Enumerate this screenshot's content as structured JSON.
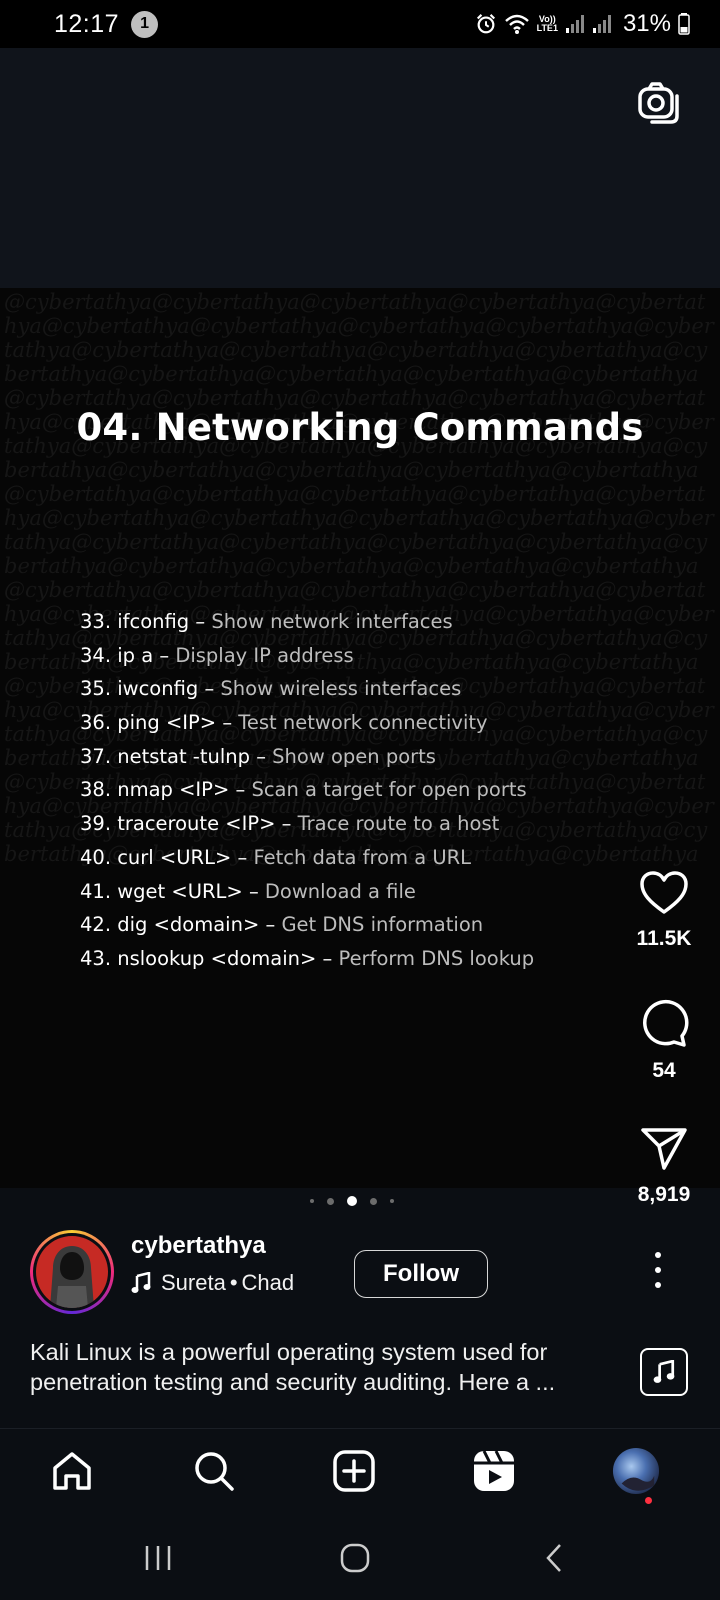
{
  "status_bar": {
    "time": "12:17",
    "notification_count": "1",
    "volte_top": "Vo))",
    "volte_bottom": "LTE1",
    "battery_percent": "31%"
  },
  "post": {
    "title": "04. Networking Commands",
    "commands": [
      {
        "cmd": "33. ifconfig – ",
        "desc": "Show network interfaces"
      },
      {
        "cmd": "34. ip a – ",
        "desc": "Display IP address"
      },
      {
        "cmd": "35. iwconfig – ",
        "desc": "Show wireless interfaces"
      },
      {
        "cmd": "36. ping <IP> – ",
        "desc": "Test network connectivity"
      },
      {
        "cmd": "37. netstat -tulnp – ",
        "desc": "Show open ports"
      },
      {
        "cmd": "38. nmap <IP> – ",
        "desc": "Scan a target for open ports"
      },
      {
        "cmd": "39. traceroute <IP> – ",
        "desc": "Trace route to a host"
      },
      {
        "cmd": "40. curl <URL> – ",
        "desc": "Fetch data from a URL"
      },
      {
        "cmd": "41. wget <URL> – ",
        "desc": "Download a file"
      },
      {
        "cmd": "42. dig <domain> – ",
        "desc": "Get DNS information"
      },
      {
        "cmd": "43. nslookup <domain> – ",
        "desc": "Perform DNS lookup"
      }
    ],
    "watermark_text": "@cybertathya@cybertathya@cybertathya@cybertathya@cybertathya@cybertathya@cybertathya@cybertathya@cybertathya@cybertathya@cybertathya@cybertathya@cybertathya@cybertathya@cybertathya@cybertathya@cybertathya@cybertathya@cybertathya@cybertathya@cybertathya@cybertathya@cybertathya@cybertathya@cybertathya@cybertathya@cybertathya@cybertathya@cybertathya@cybertathya@cybertathya@cybertathya@cybertathya@cybertathya@cybertathya@cybertathya@cybertathya@cybertathya@cybertathya@cybertathya@cybertathya@cybertathya@cybertathya@cybertathya@cybertathya@cybertathya@cybertathya@cybertathya@cybertathya@cybertathya@cybertathya@cybertathya@cybertathya@cybertathya@cybertathya@cybertathya@cybertathya@cybertathya@cybertathya@cybertathya@cybertathya@cybertathya@cybertathya@cybertathya@cybertathya@cybertathya@cybertathya@cybertathya@cybertathya@cybertathya@cybertathya@cybertathya@cybertathya@cybertathya@cybertathya@cybertathya@cybertathya@cybertathya@cybertathya@cybertathya@cybertathya@cybertathya@cybertathya@cybertathya@cybertathya@cybertathya@cybertathya@cybertathya@cybertathya@cybertathya@cybertathya@cybertathya@cybertathya@cybertathya@cybertathya@cybertathya@cybertathya@cybertathya@cybertathya@cybertathya@cybertathya@cybertathya@cybertathya@cybertathya@cybertathya@cybertathya@cybertathya@cybertathya@cybertathya@cybertathya@cybertathya@cybertathya@cybertathya@cybertathya",
    "carousel": {
      "total": 5,
      "active": 2
    }
  },
  "actions": {
    "likes": "11.5K",
    "comments": "54",
    "shares": "8,919"
  },
  "author": {
    "username": "cybertathya",
    "audio_artist": "Sureta",
    "audio_separator": "•",
    "audio_track": "Chad",
    "follow_label": "Follow"
  },
  "caption": "Kali Linux is a powerful operating system used for penetration testing and security auditing. Here a ...",
  "icons": {
    "camera": "camera-icon",
    "like": "heart-icon",
    "comment": "comment-icon",
    "share": "send-icon",
    "music": "music-note-icon",
    "home": "home-icon",
    "search": "search-icon",
    "create": "plus-square-icon",
    "reels": "reels-icon",
    "recents": "recent-apps-icon",
    "home_sys": "home-circle-icon",
    "back": "back-icon"
  },
  "colors": {
    "background": "#0b0e13",
    "notification_dot": "#ff3040",
    "avatar_bg": "#c62a24"
  }
}
